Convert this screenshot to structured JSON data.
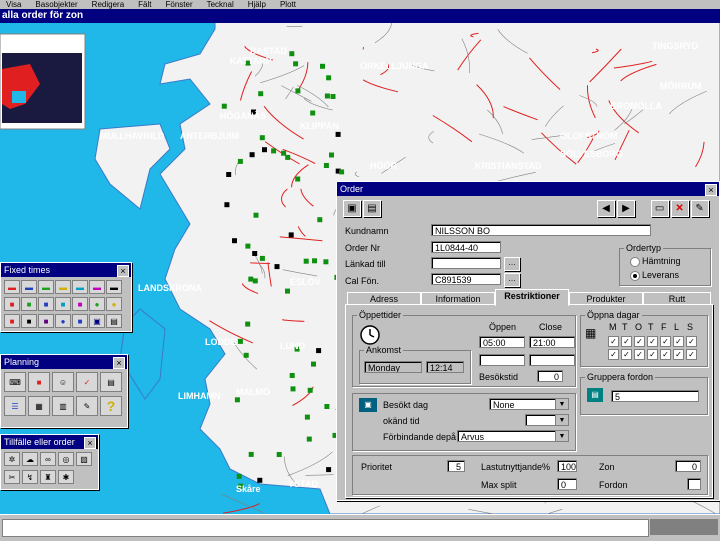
{
  "menubar": {
    "items": [
      "Visa",
      "Basobjekter",
      "Redigera",
      "Fält",
      "Fönster",
      "Tecknal",
      "Hjälp",
      "Plott"
    ]
  },
  "map_window": {
    "title": "alla order för zon"
  },
  "map_labels": [
    "MULLHAVRILD",
    "ANTERBJUIM",
    "LANDSKRONA",
    "MALMÖ",
    "LODDE",
    "Skåre",
    "LIMHAMN",
    "HÖGANÄS",
    "KATTARP",
    "BASTAD",
    "ÖRKELLJUNGA",
    "KLIPPAN",
    "TINGSRYD",
    "OLOFSTRÖM",
    "KRISTIANSTAD",
    "BROMÖLLA",
    "MÖRRUM",
    "SÖLVESBORG",
    "LUND",
    "ESLÖV",
    "HÖÖR",
    "YSTAD"
  ],
  "toolbar_fixed": {
    "title": "Fixed times"
  },
  "toolbar_planning": {
    "title": "Planning"
  },
  "toolbar_order": {
    "title": "Tillfälle eller order"
  },
  "order_window": {
    "title": "Order",
    "fields": {
      "kund_label": "Kundnamn",
      "kund_value": "NILSSON BO",
      "order_label": "Order Nr",
      "order_value": "1L0844-40",
      "lankad_label": "Länkad till",
      "lankad_value": "",
      "cal_label": "Cal Fön.",
      "cal_value": "C891539"
    },
    "ordertyp": {
      "title": "Ordertyp",
      "options": [
        "Hämtning",
        "Leverans"
      ],
      "selected": "Leverans"
    },
    "tabs": [
      "Adress",
      "Information",
      "Restriktioner",
      "Produkter",
      "Rutt"
    ],
    "active_tab": "Restriktioner",
    "opening": {
      "title": "Öppettider",
      "open_label": "Öppen",
      "close_label": "Close",
      "open_value": "05:00",
      "close_value": "21:00",
      "besok_label": "Besökstid",
      "besok_value": "0",
      "anland_title": "Ankomst",
      "day_value": "Monday",
      "time_value": "12:14"
    },
    "days": {
      "title": "Öppna dagar",
      "letters": [
        "M",
        "T",
        "O",
        "T",
        "F",
        "L",
        "S"
      ],
      "checked_rows": 2
    },
    "depot": {
      "besok_label": "Besökt dag",
      "besok_value": "None",
      "okand_label": "okänd tid",
      "forbind_label": "Förbindande depå",
      "forbind_value": "Arvus"
    },
    "fordon_restr": {
      "title": "Gruppera fordon",
      "value": "5"
    },
    "bottom": {
      "prio_label": "Prioritet",
      "prio_value": "5",
      "last_label": "Lastutnyttjande%",
      "last_value": "100",
      "max_label": "Max split",
      "max_value": "0",
      "zon_label": "Zon",
      "zon_value": "0",
      "fordon_label": "Fordon",
      "fordon_value": ""
    }
  },
  "colors": {
    "sea": "#1fb8e8",
    "land": "#f2f2f2",
    "road": "#e02020",
    "title_bar": "#000080"
  }
}
